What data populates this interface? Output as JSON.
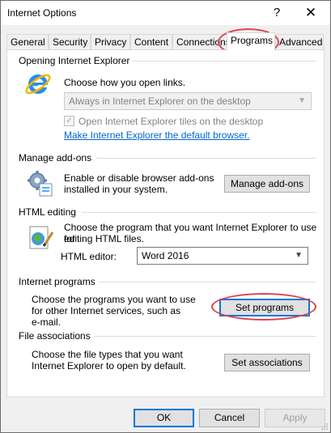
{
  "window": {
    "title": "Internet Options",
    "help_glyph": "?",
    "close_glyph": "✕"
  },
  "tabs": [
    {
      "label": "General"
    },
    {
      "label": "Security"
    },
    {
      "label": "Privacy"
    },
    {
      "label": "Content"
    },
    {
      "label": "Connections"
    },
    {
      "label": "Programs",
      "active": true
    },
    {
      "label": "Advanced"
    }
  ],
  "opening_ie": {
    "heading": "Opening Internet Explorer",
    "prompt": "Choose how you open links.",
    "dropdown_value": "Always in Internet Explorer on the desktop",
    "tiles_checkbox_label": "Open Internet Explorer tiles on the desktop",
    "tiles_checked": true,
    "default_link": "Make Internet Explorer the default browser."
  },
  "addons": {
    "heading": "Manage add-ons",
    "description_line1": "Enable or disable browser add-ons",
    "description_line2": "installed in your system.",
    "button": "Manage add-ons"
  },
  "html_editing": {
    "heading": "HTML editing",
    "description_line1": "Choose the program that you want Internet Explorer to use for",
    "description_line2": "editing HTML files.",
    "editor_label": "HTML editor:",
    "editor_value": "Word 2016"
  },
  "internet_programs": {
    "heading": "Internet programs",
    "description_line1": "Choose the programs you want to use",
    "description_line2": "for other Internet services, such as",
    "description_line3": "e-mail.",
    "button": "Set programs"
  },
  "file_associations": {
    "heading": "File associations",
    "description_line1": "Choose the file types that you want",
    "description_line2": "Internet Explorer to open by default.",
    "button": "Set associations"
  },
  "footer": {
    "ok": "OK",
    "cancel": "Cancel",
    "apply": "Apply"
  },
  "colors": {
    "annotation": "#e0414b",
    "link": "#0066cc",
    "focus": "#0078d7"
  }
}
